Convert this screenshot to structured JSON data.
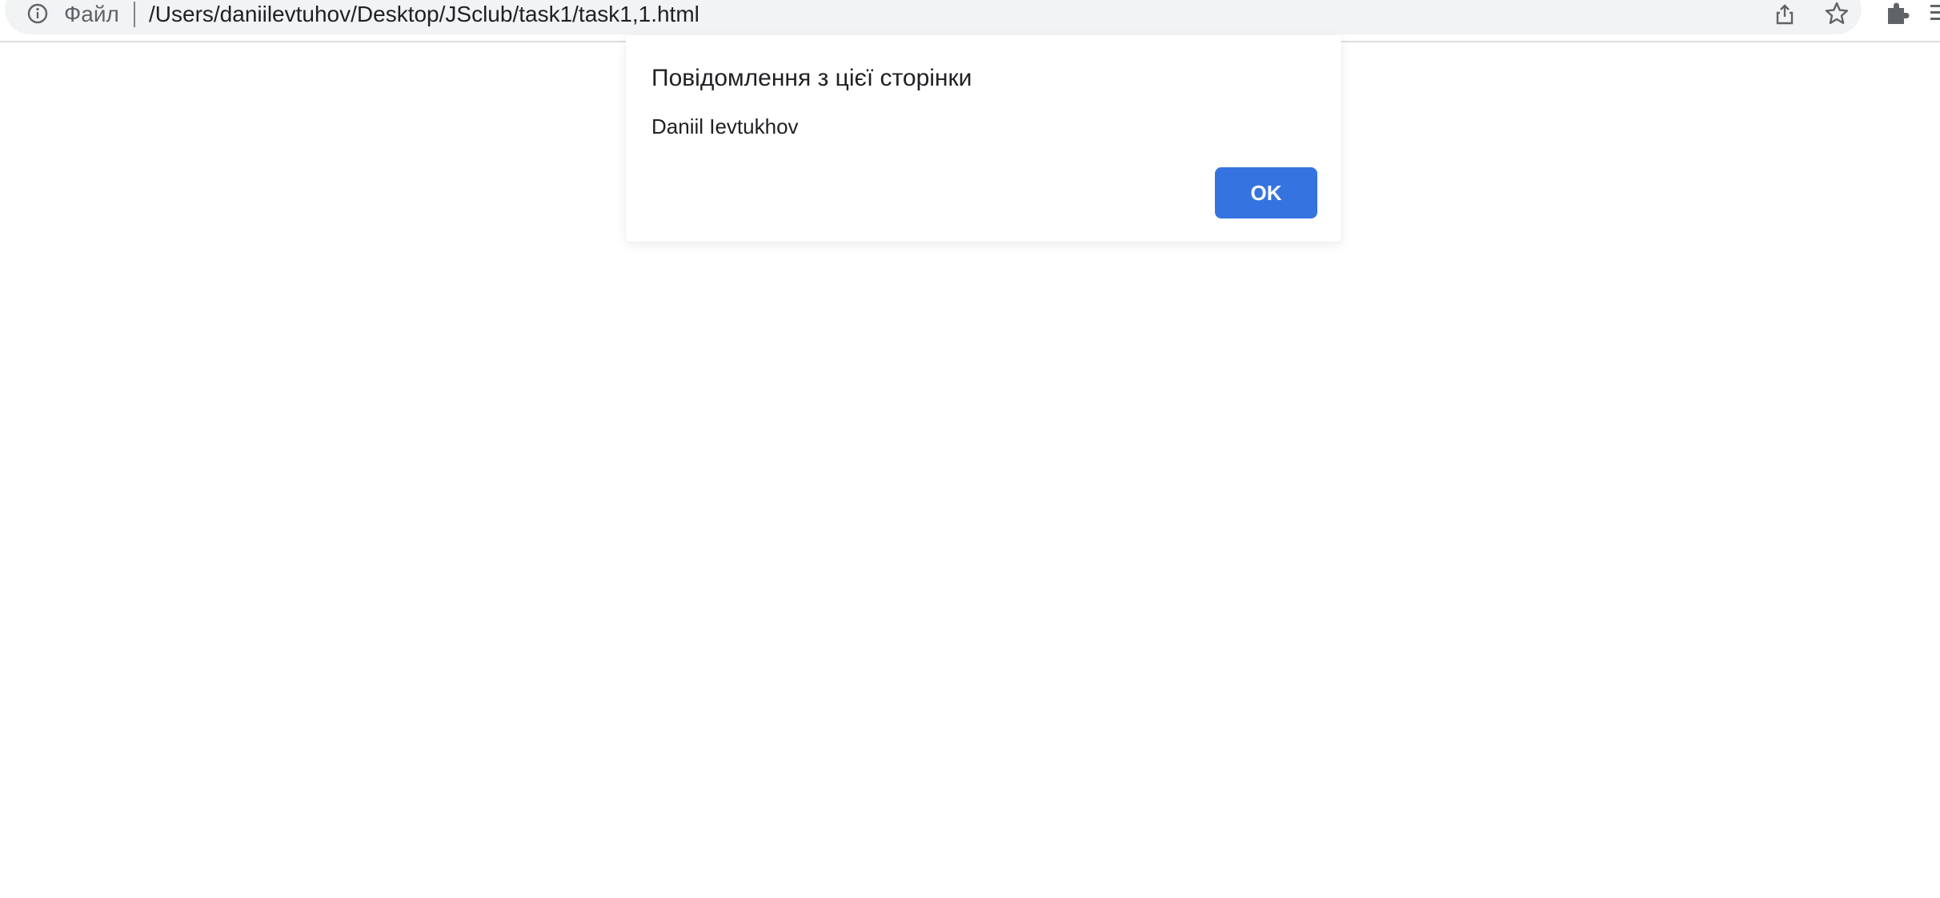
{
  "address_bar": {
    "scheme_label": "Файл",
    "url": "/Users/daniilevtuhov/Desktop/JSclub/task1/task1,1.html"
  },
  "toolbar_icons": [
    "info-icon",
    "share-icon",
    "star-icon",
    "extensions-icon",
    "menu-icon"
  ],
  "dialog": {
    "title": "Повідомлення з цієї сторінки",
    "message": "Daniil Ievtukhov",
    "ok_label": "OK"
  },
  "colors": {
    "accent": "#3574e0",
    "omnibox_bg": "#f1f3f4",
    "text": "#202124",
    "muted": "#5f6368"
  }
}
